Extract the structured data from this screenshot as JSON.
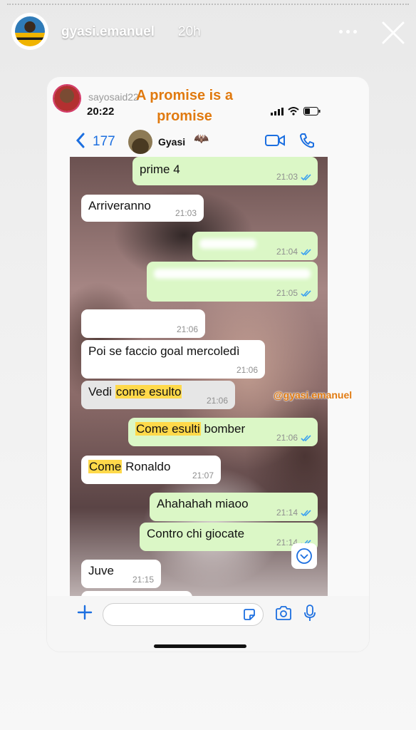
{
  "story": {
    "username": "gyasi.emanuel",
    "time": "20h",
    "more_icon": "more-horizontal-icon",
    "close_icon": "close-icon"
  },
  "inner": {
    "sub_username": "sayosaid22",
    "time": "20:22",
    "caption_line1": "A promise is a",
    "caption_line2": "promise",
    "back_count": "177",
    "contact_name": "Gyasi",
    "contact_emoji": "🦇",
    "mention": "@gyasi.emanuel"
  },
  "messages": [
    {
      "dir": "out",
      "text": "prime 4",
      "time": "21:03"
    },
    {
      "dir": "in",
      "text": "Arriveranno",
      "time": "21:03"
    },
    {
      "dir": "out",
      "text": "",
      "time": "21:04"
    },
    {
      "dir": "out",
      "text": "",
      "time": "21:05"
    },
    {
      "dir": "in",
      "text": "",
      "time": "21:06"
    },
    {
      "dir": "in",
      "text": "Poi se faccio goal mercoledì",
      "time": "21:06"
    },
    {
      "dir": "in",
      "pre": "Vedi ",
      "hl": "come esulto",
      "post": "",
      "time": "21:06"
    },
    {
      "dir": "out",
      "pre": "",
      "hl": "Come esulti",
      "post": " bomber",
      "time": "21:06"
    },
    {
      "dir": "in",
      "pre": "",
      "hl": "Come",
      "post": " Ronaldo",
      "time": "21:07"
    },
    {
      "dir": "out",
      "text": "Ahahahah miaoo",
      "time": "21:14"
    },
    {
      "dir": "out",
      "text": "Contro chi giocate",
      "time": "21:14"
    },
    {
      "dir": "in",
      "text": "Juve",
      "time": "21:15"
    }
  ],
  "colors": {
    "accent": "#1c6fe0",
    "caption": "#e07a10",
    "outgoing_bubble": "#dbf7c6",
    "highlight": "#ffd94a"
  }
}
